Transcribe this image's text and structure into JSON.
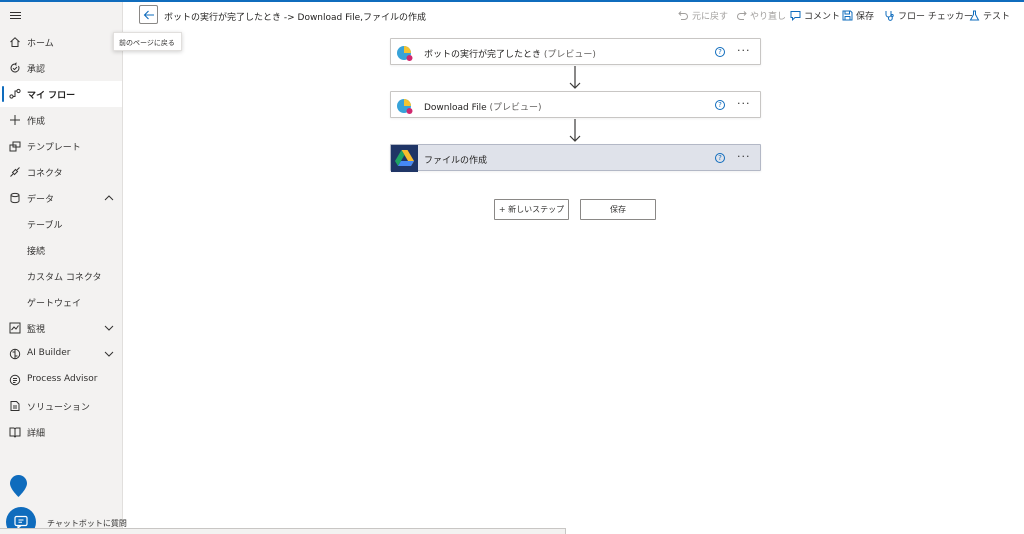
{
  "colors": {
    "accent": "#0f6cbd",
    "sidebar_bg": "#f3f2f1",
    "selected_card_bg": "#dfe2ea"
  },
  "sidebar": {
    "menu_icon": "hamburger-icon",
    "items": [
      {
        "label": "ホーム",
        "icon": "home-icon"
      },
      {
        "label": "承認",
        "icon": "approvals-icon"
      },
      {
        "label": "マイ フロー",
        "icon": "flow-icon",
        "active": true
      },
      {
        "label": "作成",
        "icon": "plus-icon"
      },
      {
        "label": "テンプレート",
        "icon": "templates-icon"
      },
      {
        "label": "コネクタ",
        "icon": "connector-icon"
      },
      {
        "label": "データ",
        "icon": "database-icon",
        "expanded": true
      },
      {
        "label": "テーブル"
      },
      {
        "label": "接続"
      },
      {
        "label": "カスタム コネクタ"
      },
      {
        "label": "ゲートウェイ"
      },
      {
        "label": "監視",
        "icon": "monitor-icon",
        "expanded": false
      },
      {
        "label": "AI Builder",
        "icon": "ai-builder-icon",
        "expanded": false
      },
      {
        "label": "Process Advisor",
        "icon": "process-advisor-icon"
      },
      {
        "label": "ソリューション",
        "icon": "solutions-icon"
      },
      {
        "label": "詳細",
        "icon": "learn-icon"
      }
    ],
    "chatbot_label": "チャットボットに質問"
  },
  "header": {
    "title": "ボットの実行が完了したとき -> Download File,ファイルの作成",
    "back_tooltip": "前のページに戻る",
    "toolbar": {
      "undo": "元に戻す",
      "redo": "やり直し",
      "comment": "コメント",
      "save": "保存",
      "flow_checker": "フロー チェッカー",
      "test": "テスト"
    }
  },
  "flow": {
    "steps": [
      {
        "title": "ボットの実行が完了したとき",
        "suffix": "(プレビュー)",
        "icon": "desktop-flow-icon"
      },
      {
        "title": "Download File",
        "suffix": "(プレビュー)",
        "icon": "desktop-flow-icon"
      },
      {
        "title": "ファイルの作成",
        "suffix": "",
        "icon": "google-drive-icon",
        "selected": true
      }
    ],
    "help_glyph": "?",
    "more_glyph": "···",
    "new_step_label": "+ 新しいステップ",
    "save_label": "保存"
  }
}
